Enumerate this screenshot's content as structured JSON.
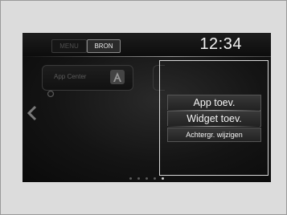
{
  "statusbar": {
    "menu_label": "MENU",
    "source_label": "BRON",
    "clock": "12:34"
  },
  "home": {
    "app_center_label": "App Center",
    "app_center_icon": "app-center-icon",
    "left_arrow_icon": "chevron-left-icon",
    "page_dots_count": 5,
    "active_page_index": 4
  },
  "context_menu": {
    "items": [
      {
        "label": "App toev."
      },
      {
        "label": "Widget toev."
      },
      {
        "label": "Achtergr. wijzigen"
      }
    ]
  },
  "colors": {
    "screen_bg": "#141414",
    "text": "#f4f4f4",
    "dim_text": "#5c5c5c"
  }
}
